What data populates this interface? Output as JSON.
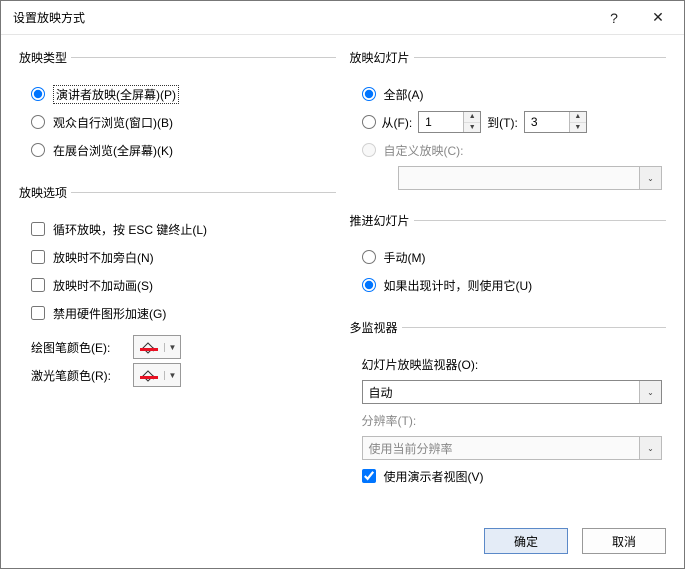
{
  "window": {
    "title": "设置放映方式",
    "help": "?",
    "close": "✕"
  },
  "showType": {
    "legend": "放映类型",
    "presenter": "演讲者放映(全屏幕)(P)",
    "browse": "观众自行浏览(窗口)(B)",
    "kiosk": "在展台浏览(全屏幕)(K)"
  },
  "showOptions": {
    "legend": "放映选项",
    "loop": "循环放映，按 ESC 键终止(L)",
    "noNarration": "放映时不加旁白(N)",
    "noAnimation": "放映时不加动画(S)",
    "disableHW": "禁用硬件图形加速(G)",
    "penColor": "绘图笔颜色(E):",
    "laserColor": "激光笔颜色(R):"
  },
  "slides": {
    "legend": "放映幻灯片",
    "all": "全部(A)",
    "fromLabel": "从(F):",
    "fromVal": "1",
    "toLabel": "到(T):",
    "toVal": "3",
    "custom": "自定义放映(C):",
    "customVal": ""
  },
  "advance": {
    "legend": "推进幻灯片",
    "manual": "手动(M)",
    "timings": "如果出现计时，则使用它(U)"
  },
  "monitors": {
    "legend": "多监视器",
    "monitorLabel": "幻灯片放映监视器(O):",
    "monitorVal": "自动",
    "resLabel": "分辨率(T):",
    "resVal": "使用当前分辨率",
    "presenterView": "使用演示者视图(V)"
  },
  "buttons": {
    "ok": "确定",
    "cancel": "取消"
  }
}
